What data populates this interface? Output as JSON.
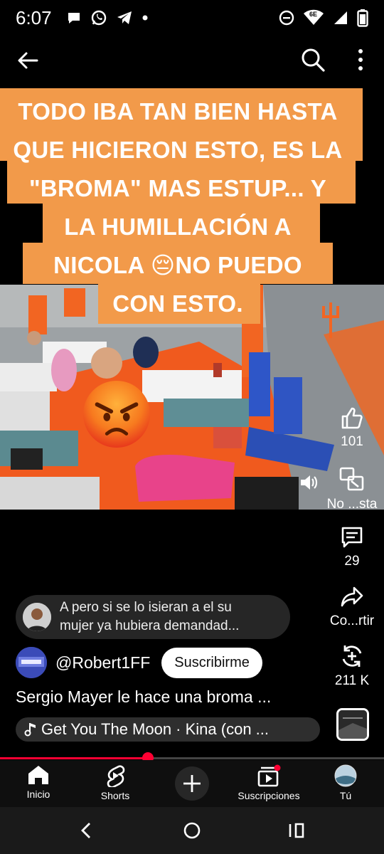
{
  "status_bar": {
    "time": "6:07",
    "network": "6E"
  },
  "caption": {
    "lines": [
      "TODO IBA TAN BIEN HASTA",
      "QUE HICIERON ESTO, ES LA",
      "\"BROMA\" MAS ESTUP... Y",
      "LA HUMILLACIÓN A",
      "NICOLA 😔NO PUEDO",
      "CON ESTO."
    ]
  },
  "actions": {
    "like_count": "101",
    "dislike_label": "No ...sta",
    "comments_count": "29",
    "share_label": "Co...rtir",
    "remix_count": "211 K"
  },
  "comment": {
    "text_line1": "A pero si se lo isieran a el su",
    "text_line2": "mujer ya hubiera demandad..."
  },
  "channel": {
    "handle": "@Robert1FF",
    "subscribe_label": "Suscribirme"
  },
  "video": {
    "title": "Sergio Mayer le hace una broma ...",
    "music": "Get You The Moon · Kina (con ...",
    "progress_fraction": 0.385
  },
  "nav": {
    "home": "Inicio",
    "shorts": "Shorts",
    "subscriptions": "Suscripciones",
    "you": "Tú"
  },
  "colors": {
    "caption_bg": "#f29a4a",
    "accent_red": "#ff0033",
    "floor_orange": "#f05a1e"
  }
}
